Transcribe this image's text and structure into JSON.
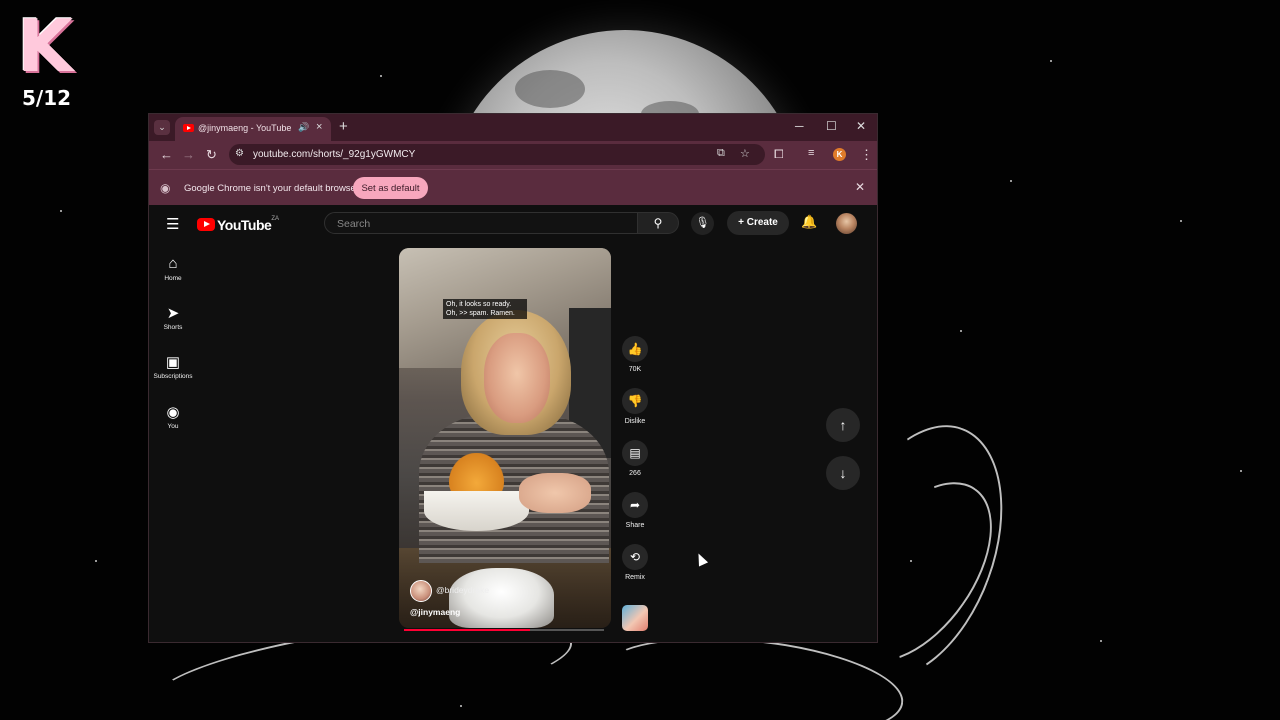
{
  "overlay": {
    "logo_letter": "K",
    "counter": "5/12"
  },
  "browser": {
    "tab": {
      "title": "@jinymaeng - YouTube"
    },
    "window_controls": {
      "minimize": "─",
      "maximize": "☐",
      "close": "✕"
    },
    "address": {
      "url": "youtube.com/shorts/_92g1yGWMCY"
    },
    "profile_initial": "K",
    "infobar": {
      "message": "Google Chrome isn't your default browser",
      "button_label": "Set as default"
    }
  },
  "youtube": {
    "logo_text": "YouTube",
    "region": "ZA",
    "search": {
      "placeholder": "Search"
    },
    "create_label": "Create",
    "sidebar": [
      {
        "label": "Home",
        "icon": "home-icon"
      },
      {
        "label": "Shorts",
        "icon": "shorts-icon"
      },
      {
        "label": "Subscriptions",
        "icon": "subscriptions-icon"
      },
      {
        "label": "You",
        "icon": "you-icon"
      }
    ],
    "short": {
      "caption": "Oh, it looks so ready. Oh, >> spam. Ramen.",
      "collaborator": "@brideydrake",
      "channel": "@jinymaeng",
      "progress": 0.63
    },
    "actions": {
      "like_count": "70K",
      "dislike_label": "Dislike",
      "comment_count": "266",
      "share_label": "Share",
      "remix_label": "Remix"
    }
  },
  "colors": {
    "tabbar": "#3b1a27",
    "toolbar": "#5a2c3e",
    "accent_button": "#f7a7bd",
    "yt_red": "#ff0000"
  }
}
